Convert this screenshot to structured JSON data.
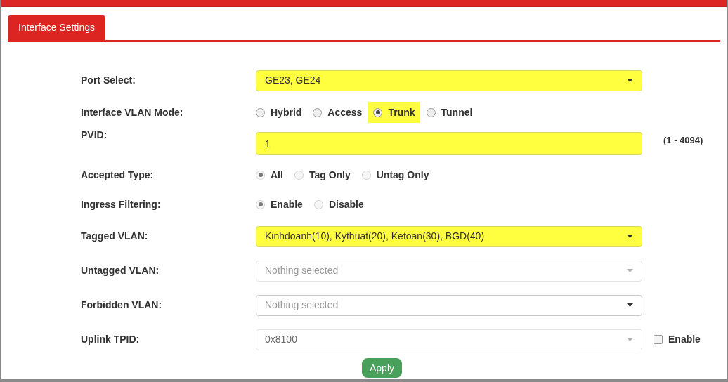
{
  "tabs": [
    {
      "label": "Interface Settings",
      "selected": true
    }
  ],
  "rows": [
    {
      "kind": "select",
      "label": "Port Select:",
      "value": "GE23, GE24",
      "highlighted": true,
      "disabled": false
    },
    {
      "kind": "radio",
      "label": "Interface VLAN Mode:",
      "disabled": false,
      "options": [
        {
          "label": "Hybrid",
          "selected": false,
          "highlighted": false
        },
        {
          "label": "Access",
          "selected": false,
          "highlighted": false
        },
        {
          "label": "Trunk",
          "selected": true,
          "highlighted": true
        },
        {
          "label": "Tunnel",
          "selected": false,
          "highlighted": false
        }
      ]
    },
    {
      "kind": "text",
      "label": "PVID:",
      "value": "1",
      "highlighted": true,
      "hint": "(1 - 4094)"
    },
    {
      "kind": "radio",
      "label": "Accepted Type:",
      "disabled": true,
      "options": [
        {
          "label": "All",
          "selected": true,
          "highlighted": false
        },
        {
          "label": "Tag Only",
          "selected": false,
          "highlighted": false
        },
        {
          "label": "Untag Only",
          "selected": false,
          "highlighted": false
        }
      ]
    },
    {
      "kind": "radio",
      "label": "Ingress Filtering:",
      "disabled": true,
      "options": [
        {
          "label": "Enable",
          "selected": true,
          "highlighted": false
        },
        {
          "label": "Disable",
          "selected": false,
          "highlighted": false
        }
      ]
    },
    {
      "kind": "select",
      "label": "Tagged VLAN:",
      "value": "Kinhdoanh(10), Kythuat(20), Ketoan(30), BGD(40)",
      "highlighted": true,
      "disabled": false
    },
    {
      "kind": "select",
      "label": "Untagged VLAN:",
      "placeholder": "Nothing selected",
      "highlighted": false,
      "disabled": true
    },
    {
      "kind": "select",
      "label": "Forbidden VLAN:",
      "placeholder": "Nothing selected",
      "highlighted": false,
      "disabled": false
    },
    {
      "kind": "select",
      "label": "Uplink TPID:",
      "value": "0x8100",
      "highlighted": false,
      "disabled": true,
      "checkbox": {
        "label": "Enable",
        "checked": false
      }
    }
  ],
  "apply_button": "Apply"
}
